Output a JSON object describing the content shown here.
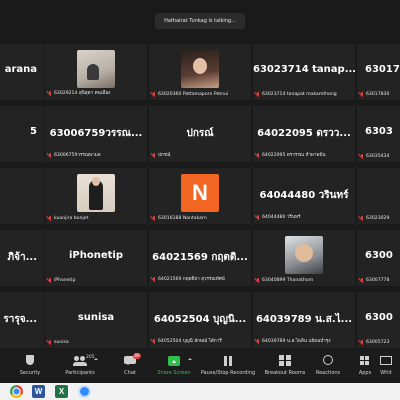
{
  "talking_indicator": "Hathairat Tunkag is talking...",
  "tiles": [
    {
      "name": "arana",
      "caption": "",
      "video": null
    },
    {
      "name": "",
      "caption": "63029214 สุนิสุดา คนเมือง",
      "video": "room"
    },
    {
      "name": "",
      "caption": "63020360 Pattamaporn Petnui",
      "video": "girl"
    },
    {
      "name": "63023714 tanap...",
      "caption": "63023714 tanapat makamthong",
      "video": null
    },
    {
      "name": "63017",
      "caption": "63017830",
      "video": null
    },
    {
      "name": "5",
      "caption": "",
      "video": null
    },
    {
      "name": "63006759วรรณ...",
      "caption": "63006759วรรณพามล",
      "video": null
    },
    {
      "name": "ปกรณ์",
      "caption": "ปกรณ์",
      "video": null
    },
    {
      "name": "64022095 ดรวว...",
      "caption": "64022095 ดรวรรณ จำพาพปัน",
      "video": null
    },
    {
      "name": "6303",
      "caption": "63035434",
      "video": null
    },
    {
      "name": "",
      "caption": "ธนิณ",
      "video": "wall"
    },
    {
      "name": "",
      "caption": "kuanjira bonjet",
      "video": "person"
    },
    {
      "name": "",
      "caption": "63016188 Nantakarn",
      "video": "avatar-n"
    },
    {
      "name": "64044480 วรินทร์",
      "caption": "64044480 วรินทร์",
      "video": null
    },
    {
      "name": "",
      "caption": "63023029",
      "video": "blur"
    },
    {
      "name": "ภิจ้า...",
      "caption": "",
      "video": null
    },
    {
      "name": "iPhonetip",
      "caption": "iPhonetip",
      "video": null
    },
    {
      "name": "64021569 กฤตติ...",
      "caption": "64021569 กฤตติยา สุวรรณทัศน์",
      "video": null
    },
    {
      "name": "",
      "caption": "63040899 Thanathorn",
      "video": "boy"
    },
    {
      "name": "6300",
      "caption": "63007778",
      "video": null
    },
    {
      "name": "รารุจ...",
      "caption": "",
      "video": null
    },
    {
      "name": "sunisa",
      "caption": "sunisa",
      "video": null
    },
    {
      "name": "64052504 บุญนิ...",
      "caption": "64052504 บุญนิ ลักษณ์ ได้การี",
      "video": null
    },
    {
      "name": "64039789 น.ส.ไ...",
      "caption": "64039789 น.ส.ไพลิน แย้มฉบำรุง",
      "video": null
    },
    {
      "name": "6300",
      "caption": "63005723",
      "video": null
    }
  ],
  "avatar_letter": "N",
  "toolbar": {
    "security": "Security",
    "participants": "Participants",
    "participants_count": "205",
    "chat": "Chat",
    "chat_badge": "89",
    "share": "Share Screen",
    "record": "Pause/Stop Recording",
    "rooms": "Breakout Rooms",
    "reactions": "Reactions",
    "apps": "Apps",
    "whiteboards": "Whit"
  },
  "taskbar": {
    "word": "W",
    "excel": "X"
  }
}
